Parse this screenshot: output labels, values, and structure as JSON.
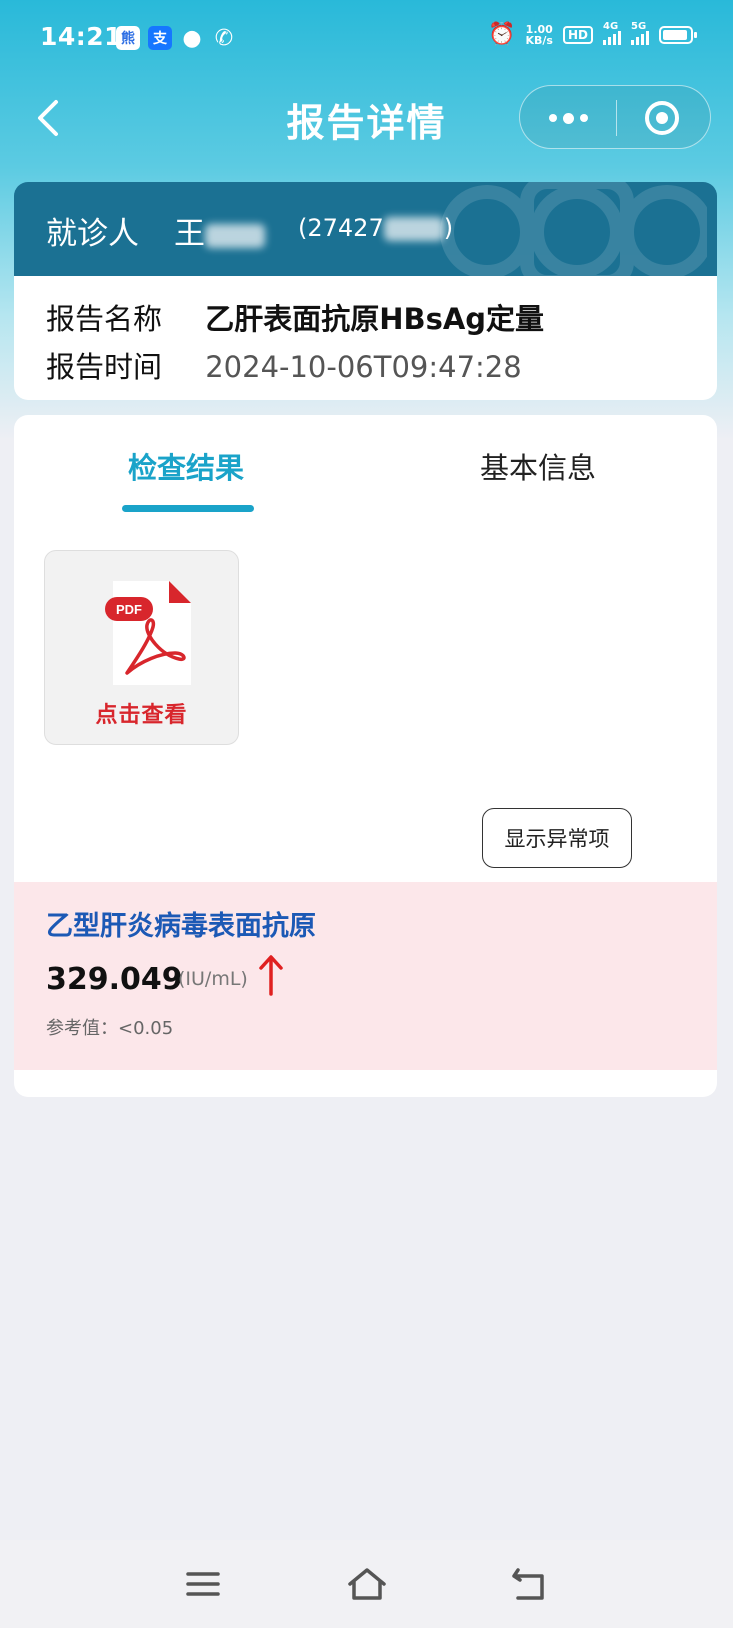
{
  "status_bar": {
    "time": "14:21",
    "net_speed_value": "1.00",
    "net_speed_unit": "KB/s",
    "hd": "HD",
    "net1": "4G",
    "net2": "5G",
    "app_icons": [
      "baidu-icon",
      "alipay-icon",
      "chat-bubble-icon",
      "phone-icon"
    ]
  },
  "nav": {
    "title": "报告详情",
    "icons": {
      "back": "chevron-left-icon",
      "more": "more-dots-icon",
      "close": "target-close-icon"
    }
  },
  "patient": {
    "label": "就诊人",
    "name": "王",
    "id_prefix": "(27427",
    "id_suffix": ")"
  },
  "report": {
    "name_label": "报告名称",
    "name_value": "乙肝表面抗原HBsAg定量",
    "time_label": "报告时间",
    "time_value": "2024-10-06T09:47:28"
  },
  "tabs": [
    {
      "label": "检查结果",
      "active": true
    },
    {
      "label": "基本信息",
      "active": false
    }
  ],
  "pdf": {
    "badge": "PDF",
    "action_label": "点击查看",
    "icon": "pdf-file-icon"
  },
  "abnormal_button": "显示异常项",
  "results": [
    {
      "name": "乙型肝炎病毒表面抗原",
      "value": "329.049",
      "unit": "(IU/mL)",
      "trend": "up",
      "reference": "参考值：<0.05"
    }
  ],
  "colors": {
    "accent": "#1aa3c9",
    "header_top": "#29b9d9",
    "patient_card": "#1b7193",
    "result_bg": "#fce7ea",
    "result_name": "#1c59b5",
    "abnormal": "#e02020",
    "pdf_red": "#d8262c"
  },
  "bottom_nav": {
    "icons": [
      "menu-icon",
      "home-icon",
      "back-icon"
    ]
  }
}
